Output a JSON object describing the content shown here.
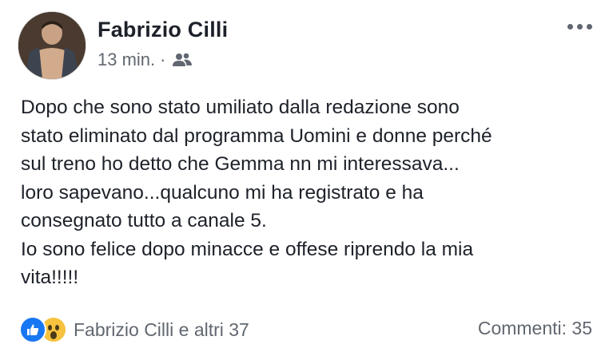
{
  "post": {
    "author": "Fabrizio Cilli",
    "time": "13 min.",
    "separator": "·",
    "audience_icon": "friends-icon",
    "more_icon": "more-options-icon",
    "text": "Dopo che sono stato umiliato dalla redazione sono\nstato eliminato dal programma Uomini e donne perché\nsul treno ho detto che Gemma nn  mi interessava...\nloro sapevano...qualcuno mi ha registrato e  ha\nconsegnato tutto a canale 5.\nIo sono felice dopo minacce e offese riprendo la mia\nvita!!!!!",
    "reactions": {
      "icons": [
        "like-icon",
        "wow-icon"
      ],
      "summary": "Fabrizio Cilli e altri 37"
    },
    "comments": "Commenti: 35"
  },
  "colors": {
    "like_blue": "#1877f2",
    "wow_yellow": "#f7c23e",
    "secondary_text": "#616770",
    "primary_text": "#1d2129"
  }
}
